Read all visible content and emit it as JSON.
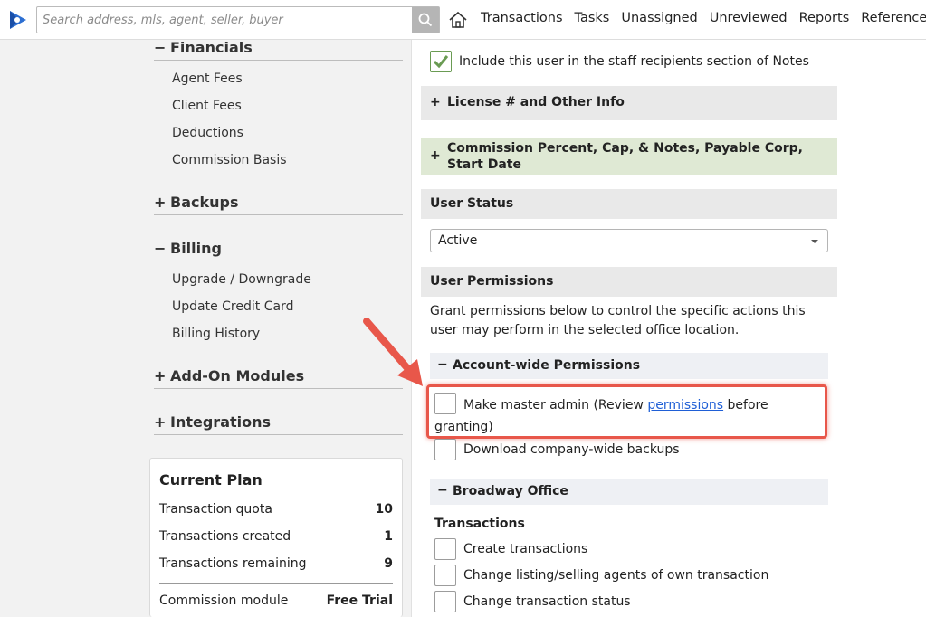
{
  "search": {
    "placeholder": "Search address, mls, agent, seller, buyer"
  },
  "nav": [
    "Transactions",
    "Tasks",
    "Unassigned",
    "Unreviewed",
    "Reports",
    "Reference"
  ],
  "sidebar": {
    "financials": {
      "sign": "−",
      "label": "Financials",
      "items": [
        "Agent Fees",
        "Client Fees",
        "Deductions",
        "Commission Basis"
      ]
    },
    "backups": {
      "sign": "+",
      "label": "Backups"
    },
    "billing": {
      "sign": "−",
      "label": "Billing",
      "items": [
        "Upgrade / Downgrade",
        "Update Credit Card",
        "Billing History"
      ]
    },
    "addons": {
      "sign": "+",
      "label": "Add-On Modules"
    },
    "integrations": {
      "sign": "+",
      "label": "Integrations"
    }
  },
  "plan": {
    "title": "Current Plan",
    "rows": [
      {
        "label": "Transaction quota",
        "value": "10"
      },
      {
        "label": "Transactions created",
        "value": "1"
      },
      {
        "label": "Transactions remaining",
        "value": "9"
      },
      {
        "label": "Commission module",
        "value": "Free Trial"
      }
    ]
  },
  "main": {
    "include_staff": "Include this user in the staff recipients section of Notes",
    "license_section": "License # and Other Info",
    "commission_section": "Commission Percent, Cap, & Notes, Payable Corp, Start Date",
    "plus_sign": "+",
    "status_title": "User Status",
    "status_value": "Active",
    "permissions_title": "User Permissions",
    "permissions_desc": "Grant permissions below to control the specific actions this user may perform in the selected office location.",
    "account_wide": {
      "sign": "−",
      "label": "Account-wide Permissions"
    },
    "master_admin_pre": "Make master admin (Review ",
    "master_admin_link": "permissions",
    "master_admin_post": " before granting)",
    "download_backups": "Download company-wide backups",
    "office": {
      "sign": "−",
      "label": "Broadway Office"
    },
    "transactions_heading": "Transactions",
    "tx_perms": [
      "Create transactions",
      "Change listing/selling agents of own transaction",
      "Change transaction status"
    ]
  },
  "colors": {
    "highlight": "#e8574a",
    "check": "#6a9b53",
    "link": "#1f5fd6",
    "green_bar": "#dfe9d4"
  }
}
